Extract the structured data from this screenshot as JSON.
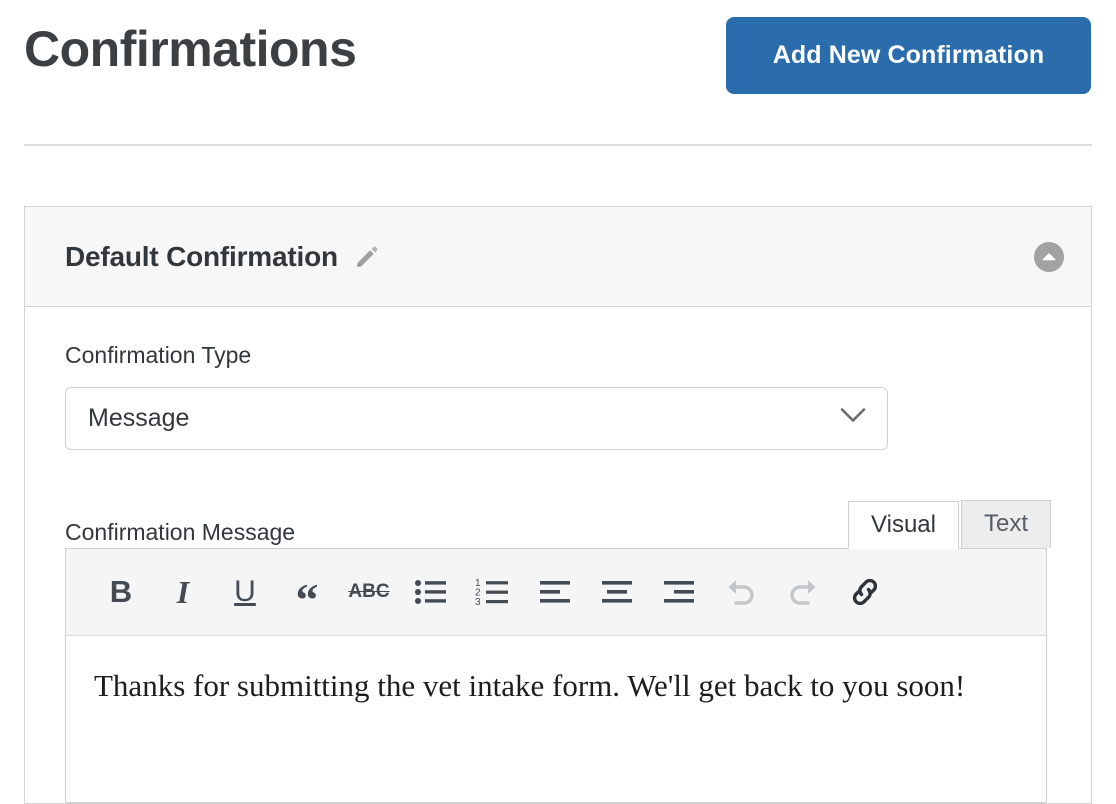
{
  "header": {
    "title": "Confirmations",
    "add_button_label": "Add New Confirmation",
    "accent_color": "#2a6cac"
  },
  "panel": {
    "title": "Default Confirmation",
    "edit_icon": "pencil-icon",
    "toggle_icon": "chevron-up-circle-icon",
    "fields": {
      "confirmation_type": {
        "label": "Confirmation Type",
        "selected_value": "Message",
        "chevron_icon": "chevron-down-icon"
      },
      "confirmation_message": {
        "label": "Confirmation Message",
        "body_text": "Thanks for submitting the vet intake form. We'll get back to you soon!"
      }
    },
    "editor": {
      "tabs": [
        {
          "label": "Visual",
          "active": true
        },
        {
          "label": "Text",
          "active": false
        }
      ],
      "toolbar": [
        {
          "name": "bold-icon",
          "glyph": "B",
          "style": "bold",
          "disabled": false
        },
        {
          "name": "italic-icon",
          "glyph": "I",
          "style": "italic",
          "disabled": false
        },
        {
          "name": "underline-icon",
          "glyph": "U",
          "style": "underline",
          "disabled": false
        },
        {
          "name": "blockquote-icon",
          "glyph": "“",
          "style": "quote",
          "disabled": false
        },
        {
          "name": "strikethrough-icon",
          "glyph": "ABC",
          "style": "strike",
          "disabled": false
        },
        {
          "name": "unordered-list-icon",
          "glyph": "",
          "style": "svg-ul",
          "disabled": false
        },
        {
          "name": "ordered-list-icon",
          "glyph": "",
          "style": "svg-ol",
          "disabled": false
        },
        {
          "name": "align-left-icon",
          "glyph": "",
          "style": "svg-align-left",
          "disabled": false
        },
        {
          "name": "align-center-icon",
          "glyph": "",
          "style": "svg-align-center",
          "disabled": false
        },
        {
          "name": "align-right-icon",
          "glyph": "",
          "style": "svg-align-right",
          "disabled": false
        },
        {
          "name": "undo-icon",
          "glyph": "",
          "style": "svg-undo",
          "disabled": true
        },
        {
          "name": "redo-icon",
          "glyph": "",
          "style": "svg-redo",
          "disabled": true
        },
        {
          "name": "link-icon",
          "glyph": "",
          "style": "svg-link",
          "disabled": false
        }
      ]
    }
  }
}
